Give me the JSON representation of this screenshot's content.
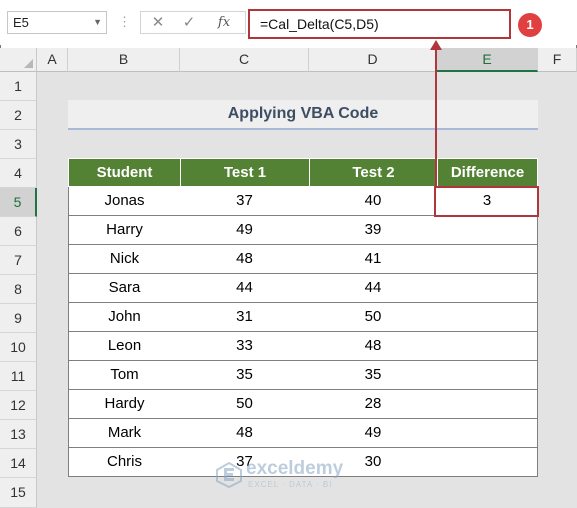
{
  "formula_bar": {
    "name_box": "E5",
    "formula": "=Cal_Delta(C5,D5)",
    "fx_label": "fx",
    "cancel_icon": "close-icon",
    "enter_icon": "checkmark-icon",
    "callout_number": "1"
  },
  "columns": [
    "A",
    "B",
    "C",
    "D",
    "E",
    "F"
  ],
  "selected_column": "E",
  "rows": [
    "1",
    "2",
    "3",
    "4",
    "5",
    "6",
    "7",
    "8",
    "9",
    "10",
    "11",
    "12",
    "13",
    "14",
    "15"
  ],
  "selected_row": "5",
  "title": "Applying VBA Code",
  "table": {
    "headers": [
      "Student",
      "Test 1",
      "Test 2",
      "Difference"
    ],
    "rows": [
      [
        "Jonas",
        "37",
        "40",
        "3"
      ],
      [
        "Harry",
        "49",
        "39",
        ""
      ],
      [
        "Nick",
        "48",
        "41",
        ""
      ],
      [
        "Sara",
        "44",
        "44",
        ""
      ],
      [
        "John",
        "31",
        "50",
        ""
      ],
      [
        "Leon",
        "33",
        "48",
        ""
      ],
      [
        "Tom",
        "35",
        "35",
        ""
      ],
      [
        "Hardy",
        "50",
        "28",
        ""
      ],
      [
        "Mark",
        "48",
        "49",
        ""
      ],
      [
        "Chris",
        "37",
        "30",
        ""
      ]
    ]
  },
  "watermark": {
    "name": "exceldemy",
    "tagline": "EXCEL · DATA · BI"
  },
  "colors": {
    "header_green": "#548235",
    "highlight_red": "#b0363b",
    "badge_red": "#e0403f",
    "title_text": "#3e4e62"
  }
}
